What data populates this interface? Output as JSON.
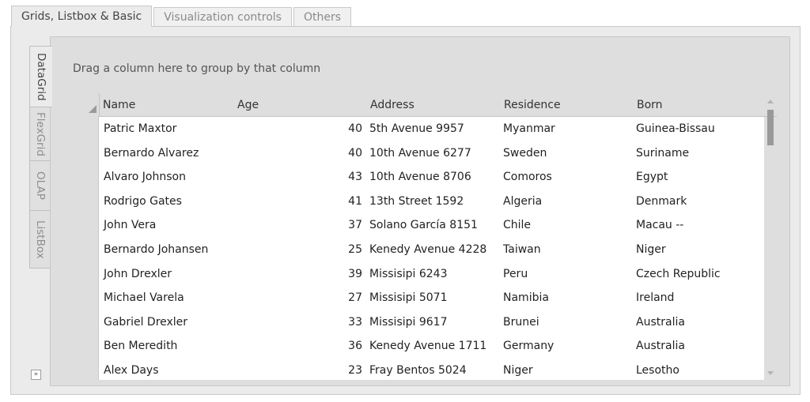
{
  "top_tabs": [
    {
      "label": "Grids, Listbox & Basic",
      "active": true
    },
    {
      "label": "Visualization controls",
      "active": false
    },
    {
      "label": "Others",
      "active": false
    }
  ],
  "side_tabs": [
    {
      "label": "DataGrid",
      "active": true
    },
    {
      "label": "FlexGrid",
      "active": false
    },
    {
      "label": "OLAP",
      "active": false
    },
    {
      "label": "ListBox",
      "active": false
    }
  ],
  "group_panel": {
    "hint": "Drag a column here to group by that column"
  },
  "grid": {
    "columns": [
      "Name",
      "Age",
      "Address",
      "Residence",
      "Born"
    ],
    "rows": [
      {
        "name": "Patric Maxtor",
        "age": "40",
        "address": "5th Avenue 9957",
        "residence": "Myanmar",
        "born": "Guinea-Bissau"
      },
      {
        "name": "Bernardo Alvarez",
        "age": "40",
        "address": "10th Avenue 6277",
        "residence": "Sweden",
        "born": "Suriname"
      },
      {
        "name": "Alvaro Johnson",
        "age": "43",
        "address": "10th Avenue 8706",
        "residence": "Comoros",
        "born": "Egypt"
      },
      {
        "name": "Rodrigo Gates",
        "age": "41",
        "address": "13th Street 1592",
        "residence": "Algeria",
        "born": "Denmark"
      },
      {
        "name": "John Vera",
        "age": "37",
        "address": "Solano García 8151",
        "residence": "Chile",
        "born": "Macau --"
      },
      {
        "name": "Bernardo Johansen",
        "age": "25",
        "address": "Kenedy Avenue 4228",
        "residence": "Taiwan",
        "born": "Niger"
      },
      {
        "name": "John Drexler",
        "age": "39",
        "address": "Missisipi 6243",
        "residence": "Peru",
        "born": "Czech Republic"
      },
      {
        "name": "Michael Varela",
        "age": "27",
        "address": "Missisipi 5071",
        "residence": "Namibia",
        "born": "Ireland"
      },
      {
        "name": "Gabriel Drexler",
        "age": "33",
        "address": "Missisipi 9617",
        "residence": "Brunei",
        "born": "Australia"
      },
      {
        "name": "Ben Meredith",
        "age": "36",
        "address": "Kenedy Avenue 1711",
        "residence": "Germany",
        "born": "Australia"
      },
      {
        "name": "Alex Days",
        "age": "23",
        "address": "Fray Bentos 5024",
        "residence": "Niger",
        "born": "Lesotho"
      }
    ]
  },
  "expand_button": {
    "glyph": "»"
  }
}
